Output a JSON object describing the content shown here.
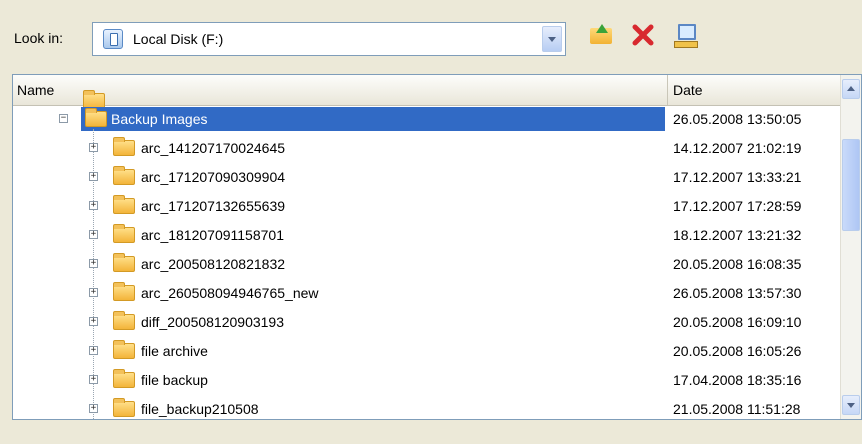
{
  "toolbar": {
    "look_in_label": "Look in:",
    "location": "Local Disk (F:)",
    "icons": [
      "folder-up-icon",
      "delete-icon",
      "network-drive-icon"
    ]
  },
  "list": {
    "columns": [
      "Name",
      "Date"
    ],
    "parent": {
      "name": "Backup Images",
      "date": "26.05.2008 13:50:05",
      "selected": true
    },
    "items": [
      {
        "name": "arc_141207170024645",
        "date": "14.12.2007 21:02:19"
      },
      {
        "name": "arc_171207090309904",
        "date": "17.12.2007 13:33:21"
      },
      {
        "name": "arc_171207132655639",
        "date": "17.12.2007 17:28:59"
      },
      {
        "name": "arc_181207091158701",
        "date": "18.12.2007 13:21:32"
      },
      {
        "name": "arc_200508120821832",
        "date": "20.05.2008 16:08:35"
      },
      {
        "name": "arc_260508094946765_new",
        "date": "26.05.2008 13:57:30"
      },
      {
        "name": "diff_200508120903193",
        "date": "20.05.2008 16:09:10"
      },
      {
        "name": "file archive",
        "date": "20.05.2008 16:05:26"
      },
      {
        "name": "file backup",
        "date": "17.04.2008 18:35:16"
      },
      {
        "name": "file_backup210508",
        "date": "21.05.2008 11:51:28"
      }
    ]
  }
}
